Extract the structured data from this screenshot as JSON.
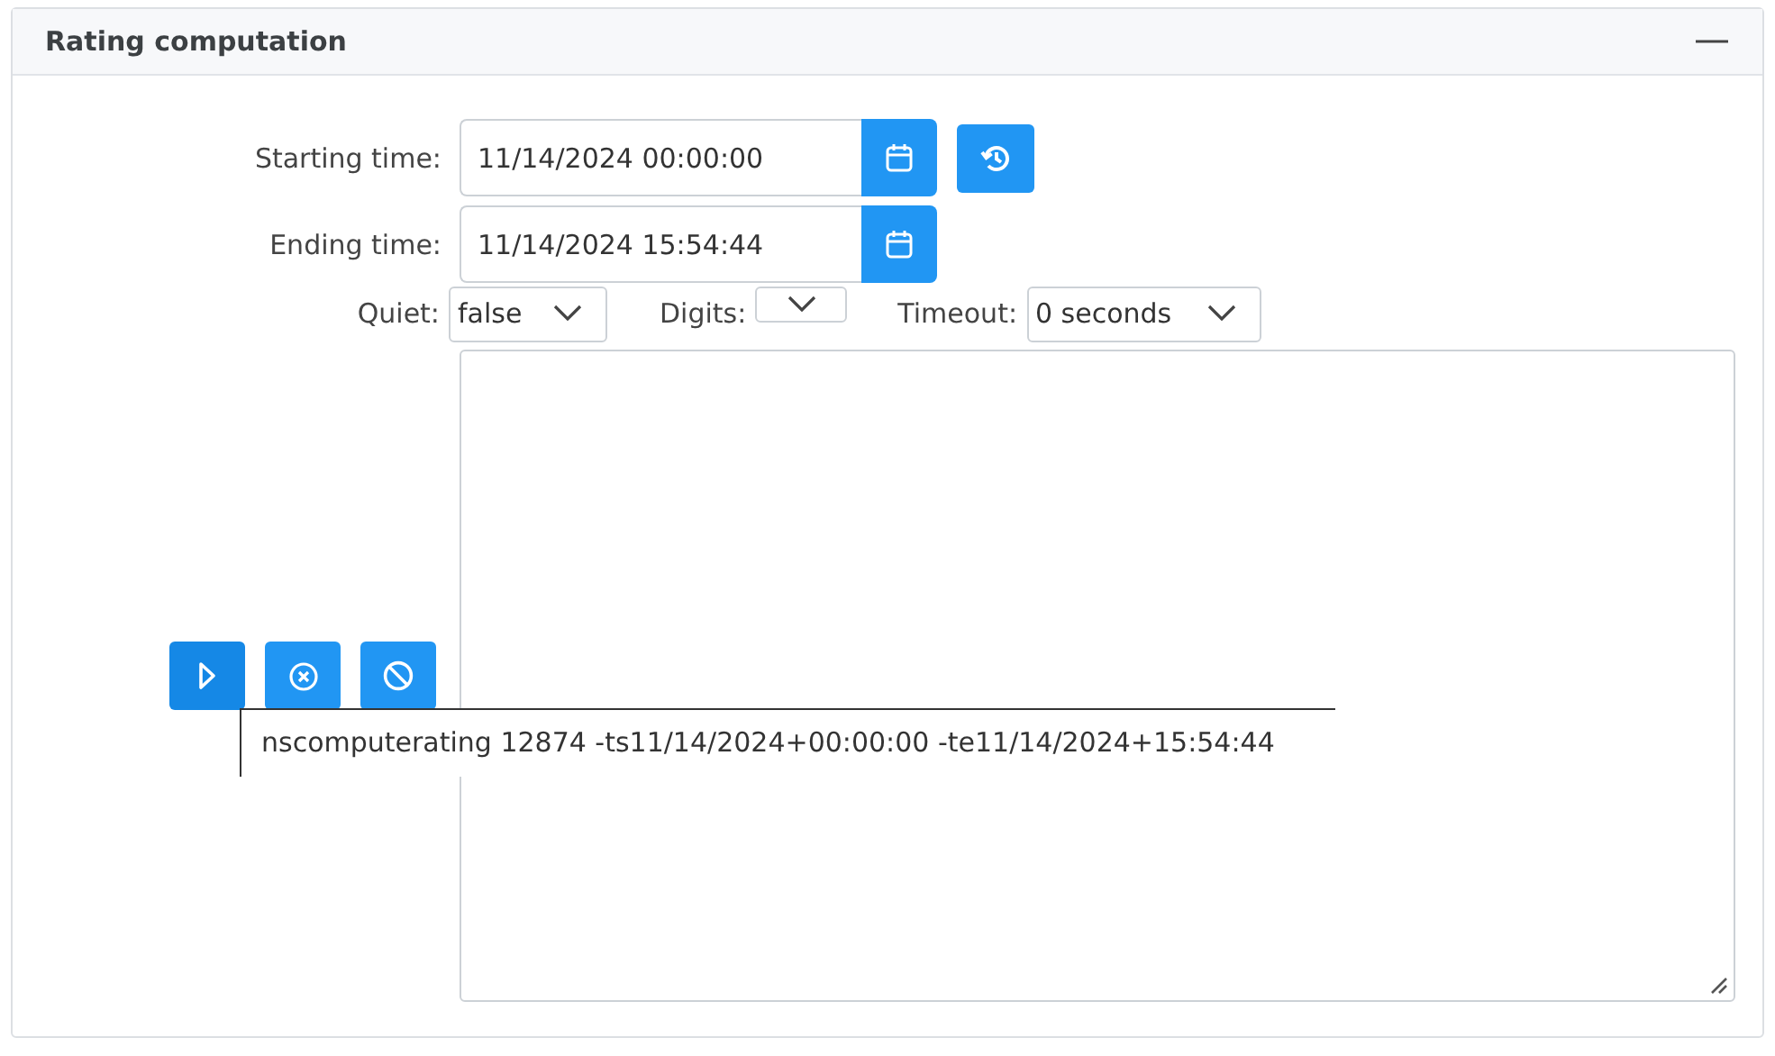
{
  "panel": {
    "title": "Rating computation",
    "expanded": true
  },
  "time_fields": [
    {
      "label": "Starting time:",
      "value": "11/14/2024 00:00:00",
      "reset_button": true
    },
    {
      "label": "Ending time:",
      "value": "11/14/2024 15:54:44",
      "reset_button": false
    }
  ],
  "options": [
    {
      "label": "Quiet:",
      "value": "false"
    },
    {
      "label": "Digits:"
    },
    {
      "label": "Timeout:",
      "value": "0 seconds"
    }
  ],
  "actions": [
    {
      "kind": "run",
      "primary": true
    },
    {
      "kind": "cancel",
      "primary": false
    },
    {
      "kind": "stop",
      "primary": false
    }
  ],
  "tooltip": "nscomputerating 12874 -ts11/14/2024+00:00:00 -te11/14/2024+15:54:44"
}
